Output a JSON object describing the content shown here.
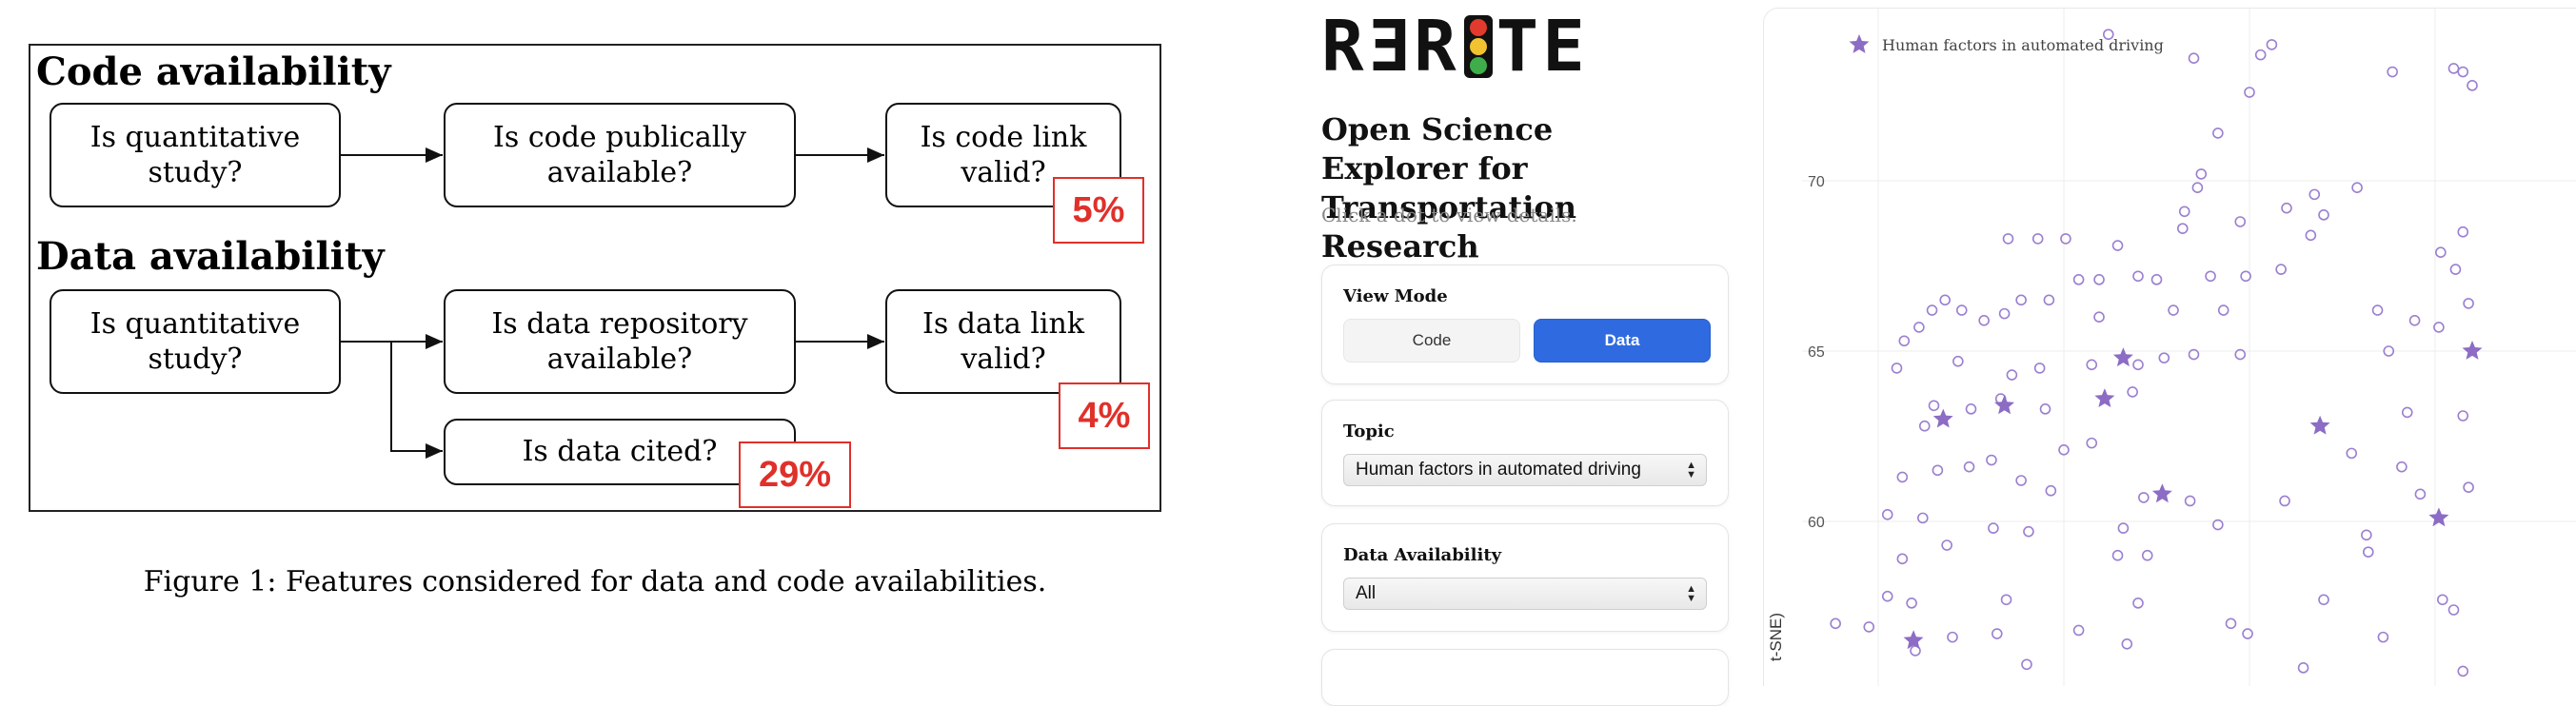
{
  "figure": {
    "sections": [
      {
        "heading": "Code availability",
        "boxes": [
          "Is quantitative study?",
          "Is code publically available?",
          "Is code link valid?"
        ],
        "percent": "5%"
      },
      {
        "heading": "Data availability",
        "boxes": [
          "Is quantitative study?",
          "Is data repository available?",
          "Is data link valid?",
          "Is data cited?"
        ],
        "percent_link": "4%",
        "percent_cited": "29%"
      }
    ],
    "caption": "Figure 1: Features considered for data and code availabilities."
  },
  "app": {
    "logo": "RERITE",
    "logo_lights": [
      "#e23b2e",
      "#f2c230",
      "#3fae4a"
    ],
    "title": "Open Science Explorer for Transportation Research",
    "hint": "Click a dot to view details.",
    "view_mode": {
      "label": "View Mode",
      "options": [
        "Code",
        "Data"
      ],
      "selected": "Data"
    },
    "topic": {
      "label": "Topic",
      "selected": "Human factors in automated driving"
    },
    "data_availability": {
      "label": "Data Availability",
      "selected": "All"
    },
    "colors": {
      "accent": "#2f6ae0",
      "marker": "#9b7fd0",
      "star": "#8c6cc4"
    }
  },
  "chart_data": {
    "type": "scatter",
    "legend": {
      "label": "Human factors in automated driving",
      "position": "top-left"
    },
    "ylabel": "t-SNE)",
    "xlabel": "",
    "ylim": [
      55.5,
      74.5
    ],
    "xlim": [
      0,
      40
    ],
    "yticks": [
      60,
      65,
      70
    ],
    "grid": true,
    "series": [
      {
        "name": "Human factors in automated driving",
        "marker": "star",
        "points": [
          [
            6.8,
            63.4
          ],
          [
            3.5,
            63.0
          ],
          [
            1.9,
            56.5
          ],
          [
            13.2,
            64.8
          ],
          [
            12.2,
            63.6
          ],
          [
            15.3,
            60.8
          ],
          [
            23.8,
            62.8
          ],
          [
            30.2,
            60.1
          ],
          [
            32.0,
            65.0
          ]
        ]
      },
      {
        "name": "",
        "marker": "circle-open",
        "points": [
          [
            12.4,
            74.3
          ],
          [
            17.0,
            73.6
          ],
          [
            20.6,
            73.7
          ],
          [
            21.2,
            74.0
          ],
          [
            27.7,
            73.2
          ],
          [
            31.5,
            73.2
          ],
          [
            32.0,
            72.8
          ],
          [
            31.0,
            73.3
          ],
          [
            20.0,
            72.6
          ],
          [
            18.3,
            71.4
          ],
          [
            17.4,
            70.2
          ],
          [
            17.2,
            69.8
          ],
          [
            25.8,
            69.8
          ],
          [
            23.5,
            69.6
          ],
          [
            22.0,
            69.2
          ],
          [
            24.0,
            69.0
          ],
          [
            16.5,
            69.1
          ],
          [
            16.4,
            68.6
          ],
          [
            19.5,
            68.8
          ],
          [
            7.0,
            68.3
          ],
          [
            8.6,
            68.3
          ],
          [
            10.1,
            68.3
          ],
          [
            12.9,
            68.1
          ],
          [
            23.3,
            68.4
          ],
          [
            31.5,
            68.5
          ],
          [
            10.8,
            67.1
          ],
          [
            11.9,
            67.1
          ],
          [
            14.0,
            67.2
          ],
          [
            15.0,
            67.1
          ],
          [
            17.9,
            67.2
          ],
          [
            19.8,
            67.2
          ],
          [
            21.7,
            67.4
          ],
          [
            30.3,
            67.9
          ],
          [
            31.1,
            67.4
          ],
          [
            1.4,
            65.3
          ],
          [
            2.2,
            65.7
          ],
          [
            2.9,
            66.2
          ],
          [
            3.6,
            66.5
          ],
          [
            4.5,
            66.2
          ],
          [
            5.7,
            65.9
          ],
          [
            6.8,
            66.1
          ],
          [
            7.7,
            66.5
          ],
          [
            9.2,
            66.5
          ],
          [
            11.9,
            66.0
          ],
          [
            15.9,
            66.2
          ],
          [
            18.6,
            66.2
          ],
          [
            26.9,
            66.2
          ],
          [
            28.9,
            65.9
          ],
          [
            30.2,
            65.7
          ],
          [
            31.8,
            66.4
          ],
          [
            1.0,
            64.5
          ],
          [
            4.3,
            64.7
          ],
          [
            7.2,
            64.3
          ],
          [
            8.7,
            64.5
          ],
          [
            11.5,
            64.6
          ],
          [
            14.0,
            64.6
          ],
          [
            15.4,
            64.8
          ],
          [
            17.0,
            64.9
          ],
          [
            19.5,
            64.9
          ],
          [
            27.5,
            65.0
          ],
          [
            3.0,
            63.4
          ],
          [
            5.0,
            63.3
          ],
          [
            6.6,
            63.6
          ],
          [
            9.0,
            63.3
          ],
          [
            13.7,
            63.8
          ],
          [
            28.5,
            63.2
          ],
          [
            31.5,
            63.1
          ],
          [
            2.5,
            62.8
          ],
          [
            10.0,
            62.1
          ],
          [
            11.5,
            62.3
          ],
          [
            25.5,
            62.0
          ],
          [
            28.2,
            61.6
          ],
          [
            1.3,
            61.3
          ],
          [
            3.2,
            61.5
          ],
          [
            4.9,
            61.6
          ],
          [
            6.1,
            61.8
          ],
          [
            7.7,
            61.2
          ],
          [
            9.3,
            60.9
          ],
          [
            14.3,
            60.7
          ],
          [
            16.8,
            60.6
          ],
          [
            21.9,
            60.6
          ],
          [
            29.2,
            60.8
          ],
          [
            31.8,
            61.0
          ],
          [
            0.5,
            60.2
          ],
          [
            2.4,
            60.1
          ],
          [
            6.2,
            59.8
          ],
          [
            8.1,
            59.7
          ],
          [
            13.2,
            59.8
          ],
          [
            18.3,
            59.9
          ],
          [
            26.3,
            59.6
          ],
          [
            1.3,
            58.9
          ],
          [
            3.7,
            59.3
          ],
          [
            12.9,
            59.0
          ],
          [
            14.5,
            59.0
          ],
          [
            26.4,
            59.1
          ],
          [
            1.8,
            57.6
          ],
          [
            0.5,
            57.8
          ],
          [
            6.9,
            57.7
          ],
          [
            14.0,
            57.6
          ],
          [
            24.0,
            57.7
          ],
          [
            30.4,
            57.7
          ],
          [
            31.0,
            57.4
          ],
          [
            19.0,
            57.0
          ],
          [
            -0.5,
            56.9
          ],
          [
            4.0,
            56.6
          ],
          [
            6.4,
            56.7
          ],
          [
            10.8,
            56.8
          ],
          [
            13.4,
            56.4
          ],
          [
            19.9,
            56.7
          ],
          [
            27.2,
            56.6
          ],
          [
            -2.3,
            57.0
          ],
          [
            2.0,
            56.2
          ],
          [
            8.0,
            55.8
          ],
          [
            22.9,
            55.7
          ],
          [
            31.5,
            55.6
          ]
        ]
      }
    ]
  }
}
